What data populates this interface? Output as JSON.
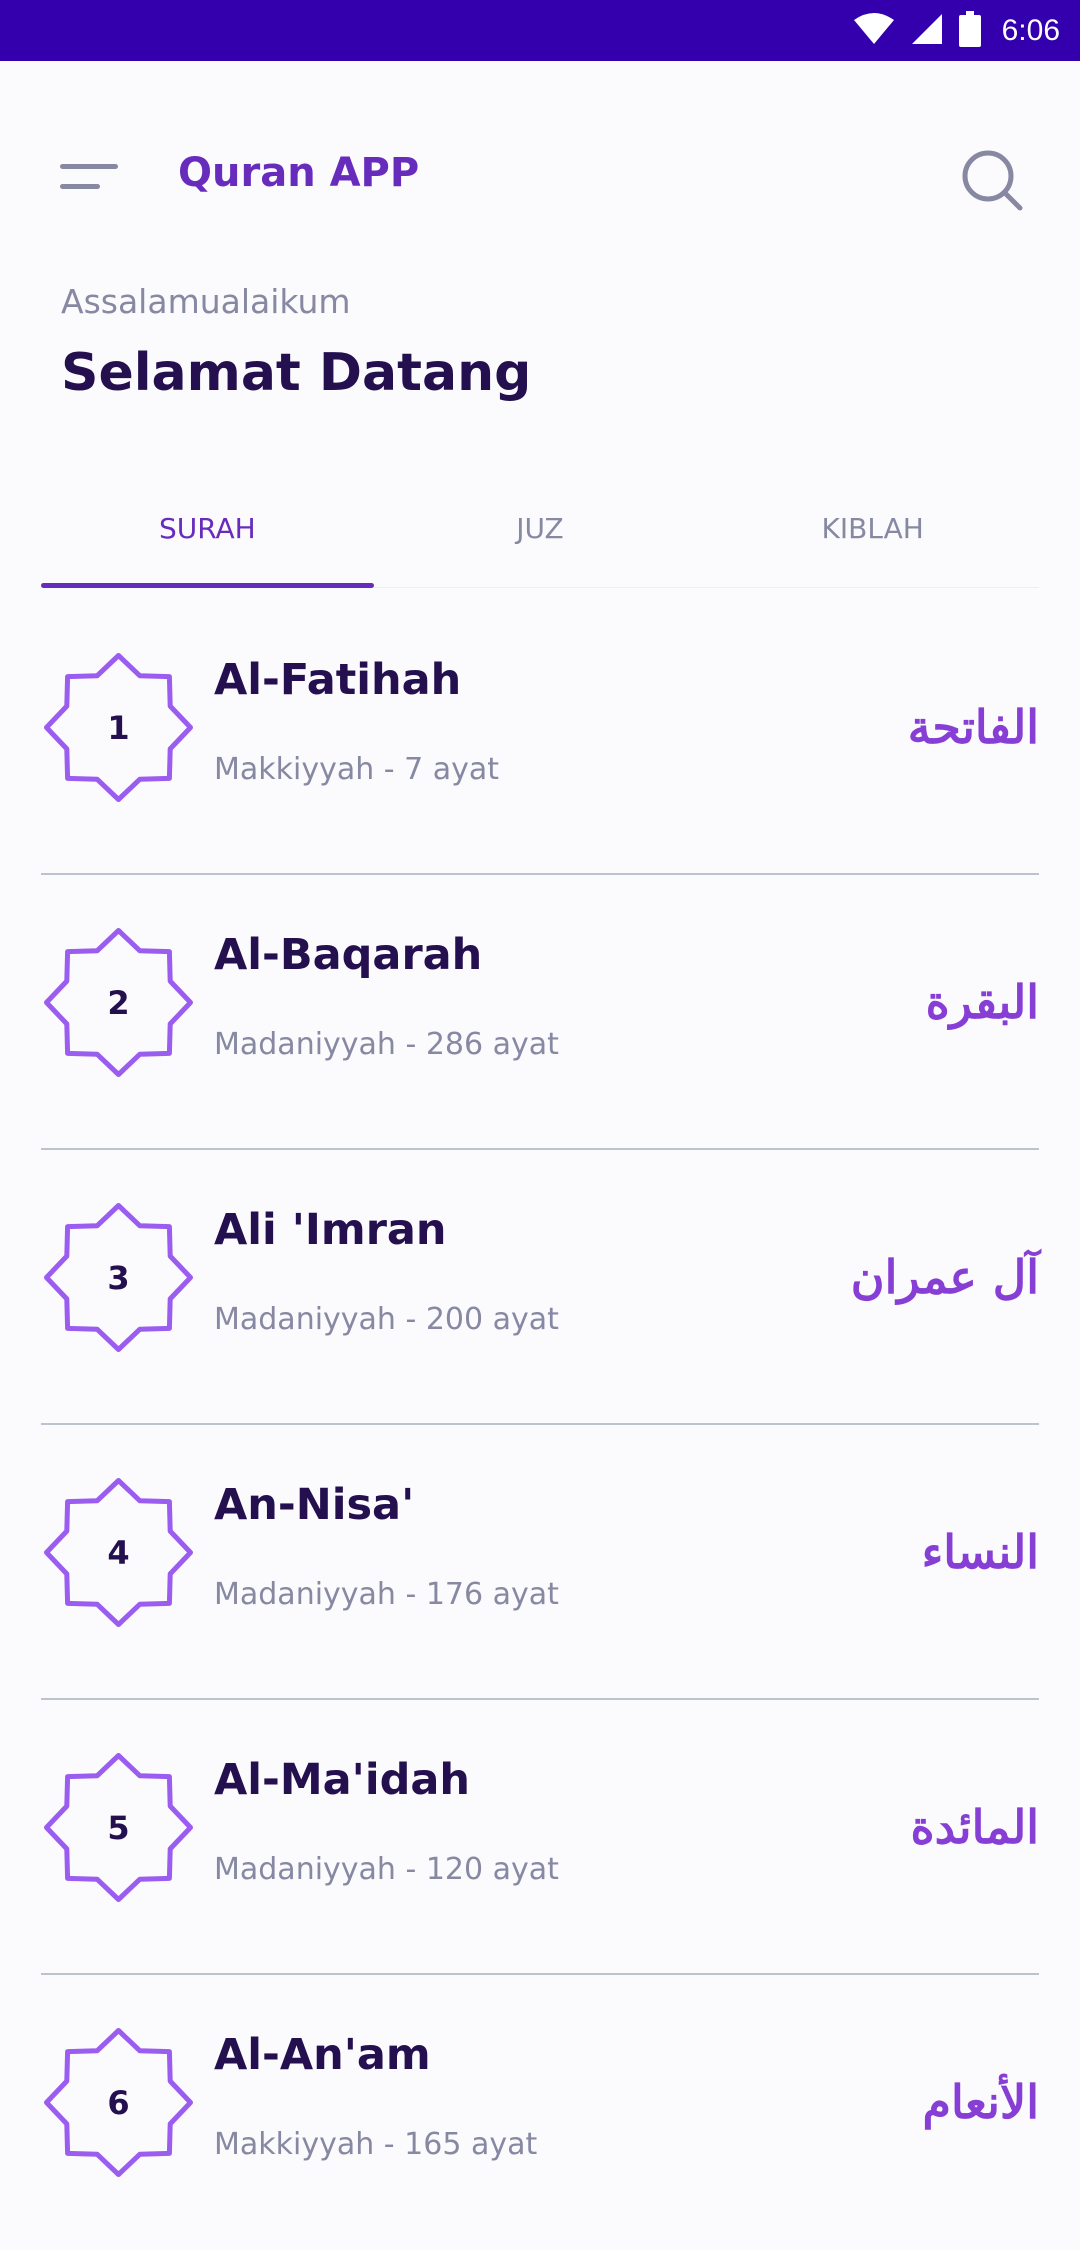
{
  "status_bar": {
    "time": "6:06",
    "icons": [
      "wifi-icon",
      "cell-signal-icon",
      "battery-icon"
    ]
  },
  "header": {
    "title": "Quran APP",
    "menu_icon": "menu-icon",
    "search_icon": "search-icon"
  },
  "greeting": {
    "salutation": "Assalamualaikum",
    "welcome": "Selamat Datang"
  },
  "tabs": [
    {
      "label": "SURAH",
      "active": true
    },
    {
      "label": "JUZ",
      "active": false
    },
    {
      "label": "KIBLAH",
      "active": false
    }
  ],
  "surahs": [
    {
      "number": "1",
      "name": "Al-Fatihah",
      "info": "Makkiyyah - 7 ayat",
      "arabic": "الفاتحة"
    },
    {
      "number": "2",
      "name": "Al-Baqarah",
      "info": "Madaniyyah - 286 ayat",
      "arabic": "البقرة"
    },
    {
      "number": "3",
      "name": "Ali 'Imran",
      "info": "Madaniyyah - 200 ayat",
      "arabic": "آل عمران"
    },
    {
      "number": "4",
      "name": "An-Nisa'",
      "info": "Madaniyyah - 176 ayat",
      "arabic": "النساء"
    },
    {
      "number": "5",
      "name": "Al-Ma'idah",
      "info": "Madaniyyah - 120 ayat",
      "arabic": "المائدة"
    },
    {
      "number": "6",
      "name": "Al-An'am",
      "info": "Makkiyyah - 165 ayat",
      "arabic": "الأنعام"
    }
  ],
  "colors": {
    "status_bar": "#3400AD",
    "accent": "#672CBC",
    "arabic_text": "#863ED5",
    "badge_outline": "#9B5DF0",
    "dark_text": "#240F4F",
    "muted_text": "#8789A3"
  }
}
